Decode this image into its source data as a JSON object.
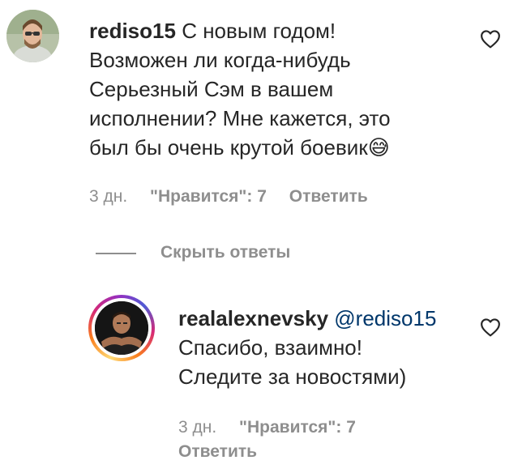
{
  "comment": {
    "username": "rediso15",
    "lines": [
      "С новым годом!",
      "Возможен ли когда-нибудь",
      "Серьезный Сэм в вашем",
      "исполнении? Мне кажется, это",
      "был бы очень крутой боевик😅"
    ],
    "time": "3 дн.",
    "likes": "\"Нравится\": 7",
    "reply_label": "Ответить"
  },
  "replies_toggle": {
    "label": "Скрыть ответы"
  },
  "reply": {
    "username": "realalexnevsky",
    "mention": "@rediso15",
    "lines": [
      "Спасибо, взаимно!",
      "Следите за новостями)"
    ],
    "time": "3 дн.",
    "likes": "\"Нравится\": 7",
    "reply_label": "Ответить"
  },
  "icons": {
    "like": "heart-outline-icon"
  }
}
